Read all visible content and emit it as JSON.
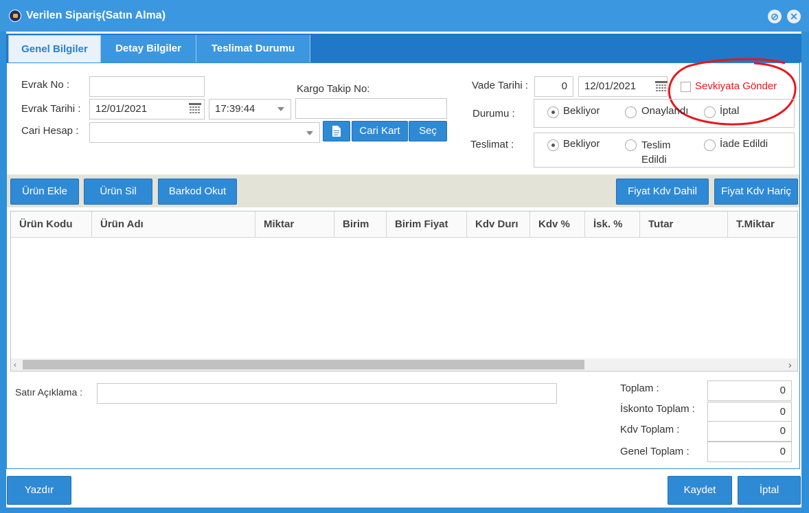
{
  "window": {
    "title": "Verilen Sipariş(Satın Alma)"
  },
  "tabs": [
    "Genel Bilgiler",
    "Detay Bilgiler",
    "Teslimat Durumu"
  ],
  "form": {
    "evrak_no_label": "Evrak No :",
    "evrak_no_value": "",
    "evrak_tarihi_label": "Evrak Tarihi :",
    "evrak_tarihi_value": "12/01/2021",
    "time_value": "17:39:44",
    "cari_hesap_label": "Cari Hesap :",
    "cari_hesap_value": "",
    "kargo_label": "Kargo Takip No:",
    "kargo_value": "",
    "cari_kart_button": "Cari Kart",
    "sec_button": "Seç",
    "vade_label": "Vade Tarihi :",
    "vade_days": "0",
    "vade_date": "12/01/2021",
    "sevkiyat_label": "Sevkiyata Gönder",
    "durumu_label": "Durumu :",
    "durumu_options": [
      "Bekliyor",
      "Onaylandı",
      "İptal"
    ],
    "teslimat_label": "Teslimat :",
    "teslimat_options": [
      "Bekliyor",
      "Teslim Edildi",
      "İade Edildi"
    ]
  },
  "toolbar": {
    "urun_ekle": "Ürün Ekle",
    "urun_sil": "Ürün Sil",
    "barkod_okut": "Barkod Okut",
    "fiyat_kdv_dahil": "Fiyat Kdv Dahil",
    "fiyat_kdv_haric": "Fiyat Kdv Hariç"
  },
  "grid": {
    "columns": [
      "Ürün Kodu",
      "Ürün Adı",
      "Miktar",
      "Birim",
      "Birim Fiyat",
      "Kdv Durı",
      "Kdv %",
      "İsk. %",
      "Tutar",
      "T.Miktar"
    ],
    "rows": []
  },
  "totals": {
    "satir_aciklama_label": "Satır Açıklama :",
    "satir_aciklama_value": "",
    "toplam_label": "Toplam :",
    "toplam_value": "0",
    "iskonto_label": "İskonto Toplam :",
    "iskonto_value": "0",
    "kdv_label": "Kdv Toplam :",
    "kdv_value": "0",
    "genel_label": "Genel Toplam :",
    "genel_value": "0"
  },
  "footer": {
    "yazdir": "Yazdır",
    "kaydet": "Kaydet",
    "iptal": "İptal"
  },
  "colors": {
    "accent": "#2f8ad6",
    "annotation": "#e8161b"
  }
}
